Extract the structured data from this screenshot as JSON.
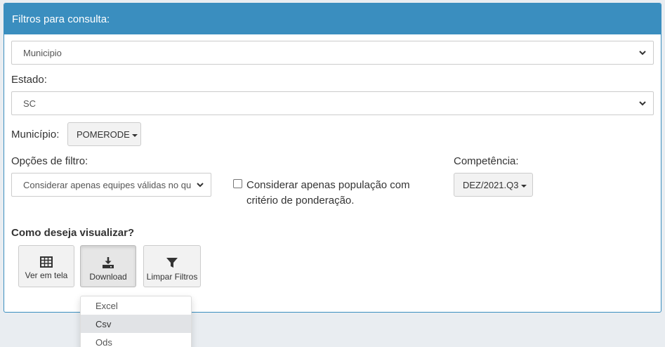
{
  "panel": {
    "title": "Filtros para consulta:"
  },
  "level_select": {
    "value": "Municipio"
  },
  "estado": {
    "label": "Estado:",
    "value": "SC"
  },
  "municipio": {
    "label": "Município:",
    "value": "POMERODE"
  },
  "filter_options": {
    "label": "Opções de filtro:",
    "value": "Considerar apenas equipes válidas no qu"
  },
  "population_checkbox": {
    "label_line1": "Considerar apenas população com",
    "label_line2": "critério de ponderação.",
    "checked": false
  },
  "competencia": {
    "label": "Competência:",
    "value": "DEZ/2021.Q3"
  },
  "view": {
    "title": "Como deseja visualizar?",
    "buttons": [
      {
        "label": "Ver em tela",
        "icon": "table-icon"
      },
      {
        "label": "Download",
        "icon": "download-icon"
      },
      {
        "label": "Limpar Filtros",
        "icon": "filter-icon"
      }
    ]
  },
  "download_menu": {
    "items": [
      "Excel",
      "Csv",
      "Ods"
    ],
    "selected": "Csv"
  }
}
